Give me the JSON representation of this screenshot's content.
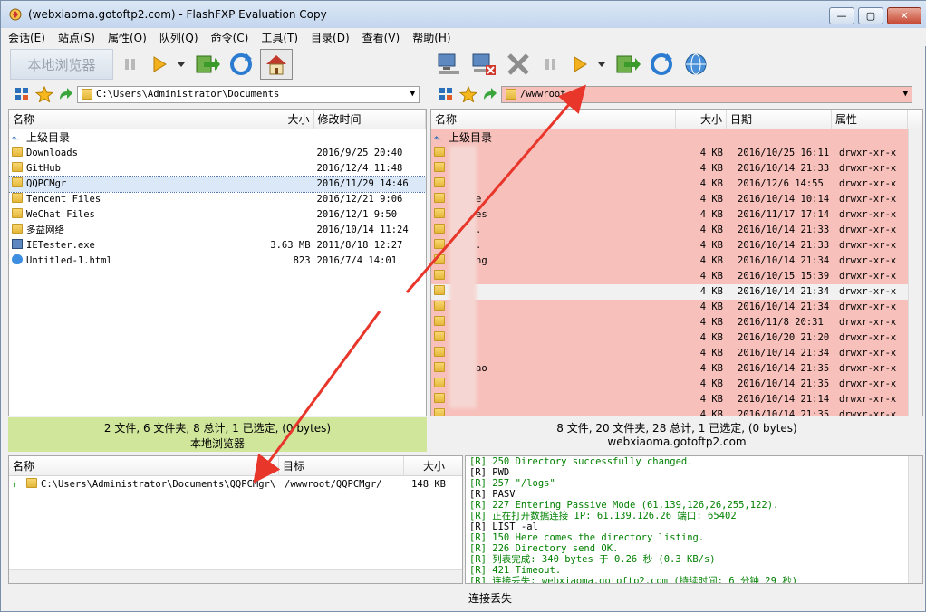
{
  "window": {
    "title": "(webxiaoma.gotoftp2.com) - FlashFXP Evaluation Copy",
    "min": "—",
    "max": "▢",
    "close": "✕"
  },
  "menu": [
    "会话(E)",
    "站点(S)",
    "属性(O)",
    "队列(Q)",
    "命令(C)",
    "工具(T)",
    "目录(D)",
    "查看(V)",
    "帮助(H)"
  ],
  "local": {
    "browser_label": "本地浏览器",
    "path": "C:\\Users\\Administrator\\Documents",
    "columns": {
      "name": "名称",
      "size": "大小",
      "modified": "修改时间"
    },
    "rows": [
      {
        "name": "上级目录",
        "size": "",
        "modified": "",
        "type": "up"
      },
      {
        "name": "Downloads",
        "size": "",
        "modified": "2016/9/25 20:40",
        "type": "folder"
      },
      {
        "name": "GitHub",
        "size": "",
        "modified": "2016/12/4 11:48",
        "type": "folder"
      },
      {
        "name": "QQPCMgr",
        "size": "",
        "modified": "2016/11/29 14:46",
        "type": "folder"
      },
      {
        "name": "Tencent Files",
        "size": "",
        "modified": "2016/12/21 9:06",
        "type": "folder"
      },
      {
        "name": "WeChat Files",
        "size": "",
        "modified": "2016/12/1 9:50",
        "type": "folder"
      },
      {
        "name": "多益网络",
        "size": "",
        "modified": "2016/10/14 11:24",
        "type": "folder"
      },
      {
        "name": "IETester.exe",
        "size": "3.63 MB",
        "modified": "2011/8/18 12:27",
        "type": "exe"
      },
      {
        "name": "Untitled-1.html",
        "size": "823",
        "modified": "2016/7/4 14:01",
        "type": "html"
      }
    ],
    "status": "2 文件, 6 文件夹, 8 总计, 1 已选定, (0 bytes)",
    "status_sub": "本地浏览器"
  },
  "remote": {
    "path": "/wwwroot",
    "columns": {
      "name": "名称",
      "size": "大小",
      "date": "日期",
      "attr": "属性"
    },
    "up_label": "上级目录",
    "rows": [
      {
        "name": "",
        "size": "4 KB",
        "date": "2016/10/25 16:11",
        "attr": "drwxr-xr-x"
      },
      {
        "name": "",
        "size": "4 KB",
        "date": "2016/10/14 21:33",
        "attr": "drwxr-xr-x"
      },
      {
        "name": "",
        "size": "4 KB",
        "date": "2016/12/6 14:55",
        "attr": "drwxr-xr-x"
      },
      {
        "name": "e",
        "size": "4 KB",
        "date": "2016/10/14 10:14",
        "attr": "drwxr-xr-x"
      },
      {
        "name": "es",
        "size": "4 KB",
        "date": "2016/11/17 17:14",
        "attr": "drwxr-xr-x"
      },
      {
        "name": ".",
        "size": "4 KB",
        "date": "2016/10/14 21:33",
        "attr": "drwxr-xr-x"
      },
      {
        "name": ".",
        "size": "4 KB",
        "date": "2016/10/14 21:33",
        "attr": "drwxr-xr-x"
      },
      {
        "name": "ng",
        "size": "4 KB",
        "date": "2016/10/14 21:34",
        "attr": "drwxr-xr-x"
      },
      {
        "name": "",
        "size": "4 KB",
        "date": "2016/10/15 15:39",
        "attr": "drwxr-xr-x"
      },
      {
        "name": "",
        "size": "4 KB",
        "date": "2016/10/14 21:34",
        "attr": "drwxr-xr-x"
      },
      {
        "name": "",
        "size": "4 KB",
        "date": "2016/10/14 21:34",
        "attr": "drwxr-xr-x"
      },
      {
        "name": "",
        "size": "4 KB",
        "date": "2016/11/8 20:31",
        "attr": "drwxr-xr-x"
      },
      {
        "name": "",
        "size": "4 KB",
        "date": "2016/10/20 21:20",
        "attr": "drwxr-xr-x"
      },
      {
        "name": "",
        "size": "4 KB",
        "date": "2016/10/14 21:34",
        "attr": "drwxr-xr-x"
      },
      {
        "name": "ao",
        "size": "4 KB",
        "date": "2016/10/14 21:35",
        "attr": "drwxr-xr-x"
      },
      {
        "name": "",
        "size": "4 KB",
        "date": "2016/10/14 21:35",
        "attr": "drwxr-xr-x"
      },
      {
        "name": "",
        "size": "4 KB",
        "date": "2016/10/14 21:14",
        "attr": "drwxr-xr-x"
      },
      {
        "name": "",
        "size": "4 KB",
        "date": "2016/10/14 21:35",
        "attr": "drwxr-xr-x"
      }
    ],
    "status": "8 文件, 20 文件夹, 28 总计, 1 已选定, (0 bytes)",
    "status_sub": "webxiaoma.gotoftp2.com"
  },
  "queue": {
    "columns": {
      "name": "名称",
      "target": "目标",
      "size": "大小"
    },
    "rows": [
      {
        "name": "C:\\Users\\Administrator\\Documents\\QQPCMgr\\",
        "target": "/wwwroot/QQPCMgr/",
        "size": "148 KB"
      }
    ]
  },
  "log": [
    {
      "t": "[R] 250 Directory successfully changed.",
      "c": "g"
    },
    {
      "t": "[R] PWD",
      "c": "k"
    },
    {
      "t": "[R] 257 \"/logs\"",
      "c": "g"
    },
    {
      "t": "[R] PASV",
      "c": "k"
    },
    {
      "t": "[R] 227 Entering Passive Mode (61,139,126,26,255,122).",
      "c": "g"
    },
    {
      "t": "[R] 正在打开数据连接 IP: 61.139.126.26 端口: 65402",
      "c": "g"
    },
    {
      "t": "[R] LIST -al",
      "c": "k"
    },
    {
      "t": "[R] 150 Here comes the directory listing.",
      "c": "g"
    },
    {
      "t": "[R] 226 Directory send OK.",
      "c": "g"
    },
    {
      "t": "[R] 列表完成: 340 bytes 于 0.26 秒 (0.3 KB/s)",
      "c": "g"
    },
    {
      "t": "[R] 421 Timeout.",
      "c": "g"
    },
    {
      "t": "[R] 连接丢失: webxiaoma.gotoftp2.com (持续时间: 6 分钟 29 秒)",
      "c": "g"
    }
  ],
  "statusbar": "连接丢失"
}
